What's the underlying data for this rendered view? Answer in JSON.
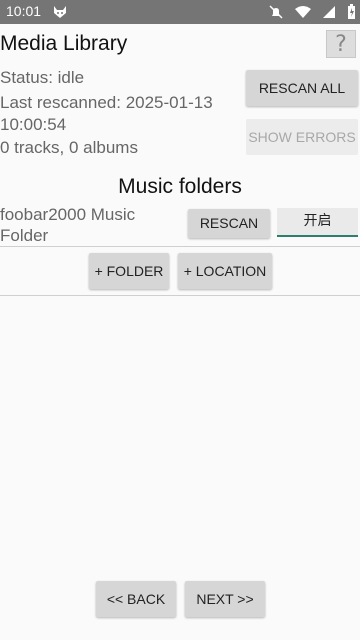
{
  "status_bar": {
    "time": "10:01",
    "icons": [
      "app-icon",
      "do-not-disturb-icon",
      "wifi-icon",
      "signal-icon",
      "battery-icon"
    ]
  },
  "header": {
    "title": "Media Library",
    "help_label": "?"
  },
  "info": {
    "status": "Status: idle",
    "last_rescanned_line1": "Last rescanned: 2025-01-13",
    "last_rescanned_line2": "10:00:54",
    "counts": "0 tracks, 0 albums"
  },
  "actions": {
    "rescan_all": "RESCAN ALL",
    "show_errors": "SHOW ERRORS"
  },
  "folders": {
    "title": "Music folders",
    "items": [
      {
        "name": "foobar2000 Music Folder",
        "rescan_label": "RESCAN",
        "toggle_label": "开启"
      }
    ],
    "add_folder": "+ FOLDER",
    "add_location": "+ LOCATION"
  },
  "nav": {
    "back": "<< BACK",
    "next": "NEXT >>"
  },
  "colors": {
    "statusbar": "#757575",
    "button": "#d6d6d6",
    "toggle_underline": "#2e7d6f"
  }
}
